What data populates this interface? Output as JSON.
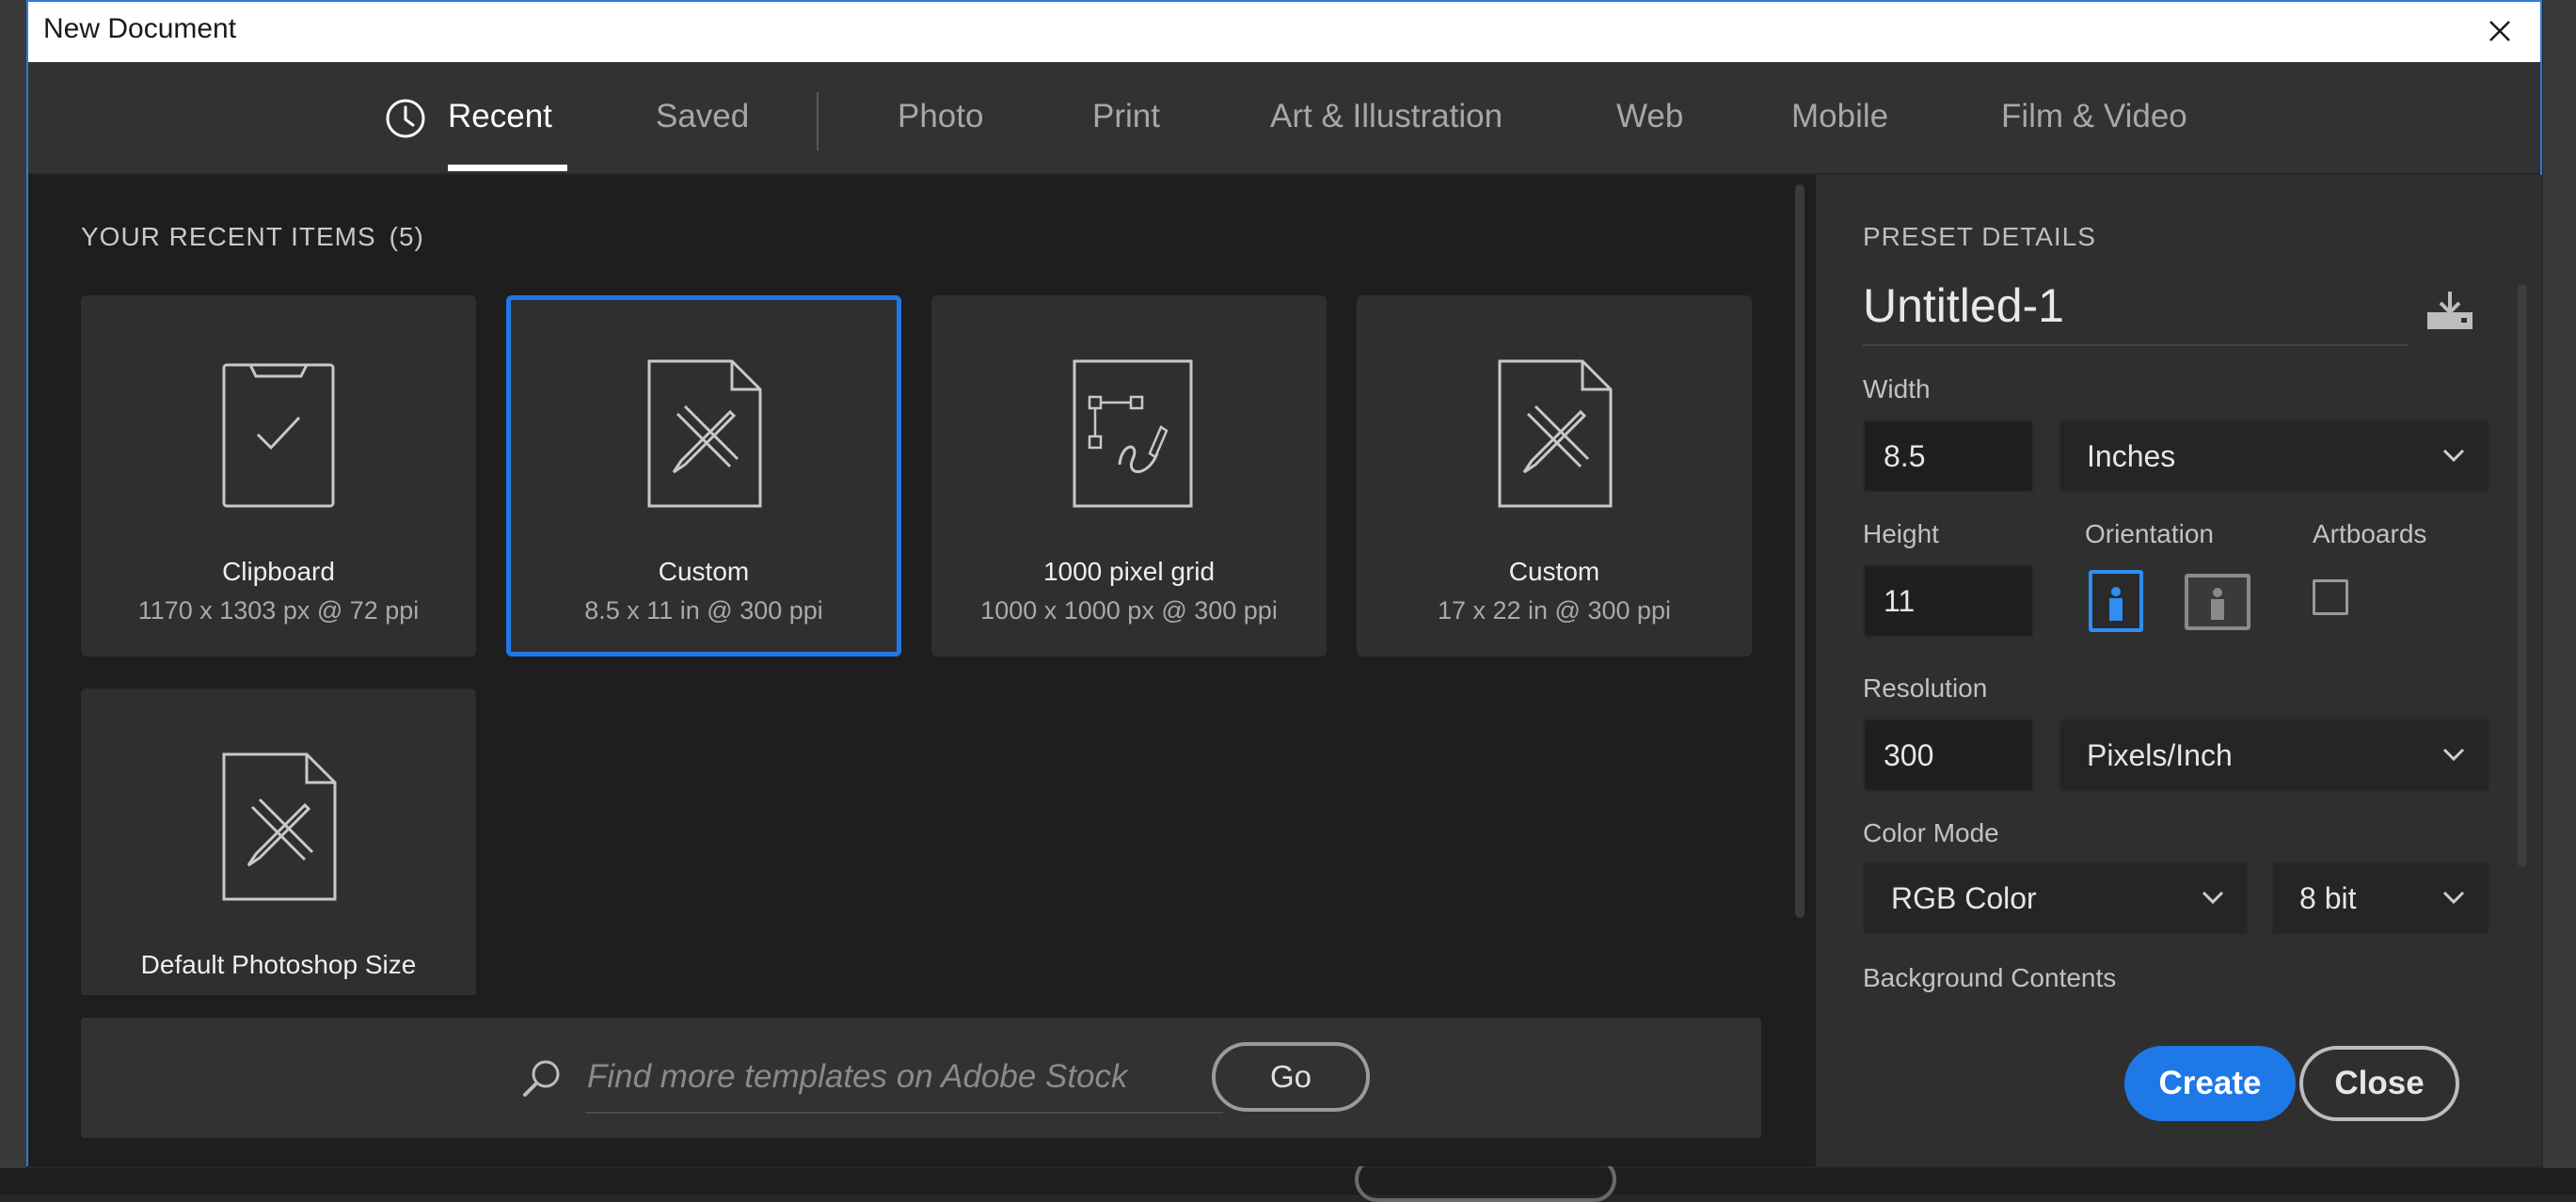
{
  "window": {
    "title": "New Document"
  },
  "tabs": [
    {
      "label": "Recent",
      "active": true
    },
    {
      "label": "Saved"
    },
    {
      "label": "Photo"
    },
    {
      "label": "Print"
    },
    {
      "label": "Art & Illustration"
    },
    {
      "label": "Web"
    },
    {
      "label": "Mobile"
    },
    {
      "label": "Film & Video"
    }
  ],
  "recent": {
    "title": "YOUR RECENT ITEMS",
    "count": "(5)",
    "items": [
      {
        "name": "Clipboard",
        "meta": "1170 x 1303 px @ 72 ppi",
        "icon": "clipboard-icon"
      },
      {
        "name": "Custom",
        "meta": "8.5 x 11 in @ 300 ppi",
        "icon": "custom-document-icon",
        "selected": true
      },
      {
        "name": "1000 pixel grid",
        "meta": "1000 x 1000 px @ 300 ppi",
        "icon": "vector-document-icon"
      },
      {
        "name": "Custom",
        "meta": "17 x 22 in @ 300 ppi",
        "icon": "custom-document-icon"
      },
      {
        "name": "Default Photoshop Size",
        "meta": "",
        "icon": "custom-document-icon"
      }
    ]
  },
  "search": {
    "placeholder": "Find more templates on Adobe Stock",
    "go_label": "Go"
  },
  "preset": {
    "header": "PRESET DETAILS",
    "name": "Untitled-1",
    "width_label": "Width",
    "width_value": "8.5",
    "width_unit": "Inches",
    "height_label": "Height",
    "height_value": "11",
    "orientation_label": "Orientation",
    "artboards_label": "Artboards",
    "resolution_label": "Resolution",
    "resolution_value": "300",
    "resolution_unit": "Pixels/Inch",
    "color_mode_label": "Color Mode",
    "color_mode": "RGB Color",
    "bit_depth": "8 bit",
    "background_label": "Background Contents"
  },
  "actions": {
    "create_label": "Create",
    "close_label": "Close"
  },
  "colors": {
    "accent": "#1e78e6",
    "panel": "#2f2f2f",
    "background": "#1e1e1e"
  }
}
